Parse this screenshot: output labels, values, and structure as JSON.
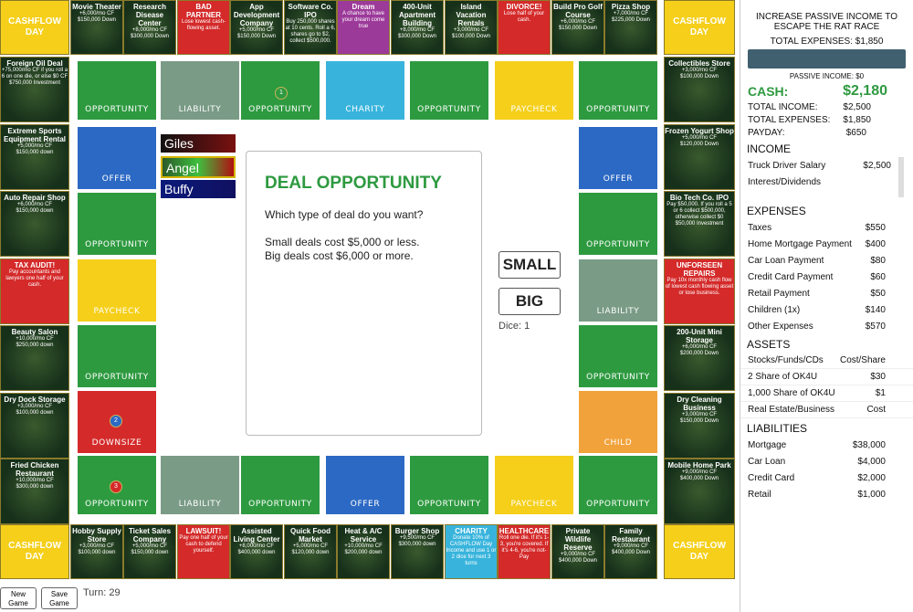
{
  "top_row": [
    {
      "title": "Movie Theater",
      "sub": "+6,000/mo CF\n$150,000 Down",
      "style": "deal"
    },
    {
      "title": "Research Disease Center",
      "sub": "+8,000/mo CF\n$300,000 Down",
      "style": "deal"
    },
    {
      "title": "BAD PARTNER",
      "sub": "Lose lowest cash-flowing asset.",
      "style": "red"
    },
    {
      "title": "App Development Company",
      "sub": "+5,000/mo CF\n$150,000 Down",
      "style": "deal"
    },
    {
      "title": "Software Co. IPO",
      "sub": "Buy 250,000 shares at 10 cents. Roll a 6, shares go to $2, collect $500,000.",
      "style": "deal"
    },
    {
      "title": "Dream",
      "sub": "A chance to have your dream come true",
      "style": "purple"
    },
    {
      "title": "400-Unit Apartment Building",
      "sub": "+8,000/mo CF\n$300,000 Down",
      "style": "deal"
    },
    {
      "title": "Island Vacation Rentals",
      "sub": "+3,000/mo CF\n$100,000 Down",
      "style": "deal"
    },
    {
      "title": "DIVORCE!",
      "sub": "Lose half of your cash.",
      "style": "red"
    },
    {
      "title": "Build Pro Golf Course",
      "sub": "+6,000/mo CF\n$150,000 Down",
      "style": "deal"
    },
    {
      "title": "Pizza Shop",
      "sub": "+7,000/mo CF\n$225,000 Down",
      "style": "deal"
    }
  ],
  "bottom_row": [
    {
      "title": "Hobby Supply Store",
      "sub": "+3,000/mo CF\n$100,000 down",
      "style": "deal"
    },
    {
      "title": "Ticket Sales Company",
      "sub": "+5,000/mo CF\n$150,000 down",
      "style": "deal"
    },
    {
      "title": "LAWSUIT!",
      "sub": "Pay one half of your cash to defend yourself.",
      "style": "red"
    },
    {
      "title": "Assisted Living Center",
      "sub": "+8,000/mo CF\n$400,000 down",
      "style": "deal"
    },
    {
      "title": "Quick Food Market",
      "sub": "+5,000/mo CF\n$120,000 down",
      "style": "deal"
    },
    {
      "title": "Heat & A/C Service",
      "sub": "+10,000/mo CF\n$200,000 down",
      "style": "deal"
    },
    {
      "title": "Burger Shop",
      "sub": "+9,500/mo CF\n$300,000 down",
      "style": "deal"
    },
    {
      "title": "CHARITY",
      "sub": "Donate 10% of CASHFLOW Day Income and use 1 or 2 dice for next 3 turns",
      "style": "cyan"
    },
    {
      "title": "HEALTHCARE",
      "sub": "Roll one die. If it's 1-3, you're covered. If it's 4-6, you're not- Pay",
      "style": "red"
    },
    {
      "title": "Private Wildlife Reserve",
      "sub": "+9,000/mo CF\n$400,000 Down",
      "style": "deal"
    },
    {
      "title": "Family Restaurant",
      "sub": "+9,000/mo CF\n$400,000 Down",
      "style": "deal"
    }
  ],
  "left_col": [
    {
      "title": "Foreign Oil Deal",
      "sub": "+75,000/mo CF if you roll a 6 on one die, or else $0 CF\n$750,000 Investment",
      "style": "deal"
    },
    {
      "title": "Extreme Sports Equipment Rental",
      "sub": "+5,000/mo CF\n$150,000 down",
      "style": "deal"
    },
    {
      "title": "Auto Repair Shop",
      "sub": "+6,000/mo CF\n$150,000 down",
      "style": "deal"
    },
    {
      "title": "TAX AUDIT!",
      "sub": "Pay accountants and lawyers one half of your cash.",
      "style": "red"
    },
    {
      "title": "Beauty Salon",
      "sub": "+10,000/mo CF\n$250,000 down",
      "style": "deal"
    },
    {
      "title": "Dry Dock Storage",
      "sub": "+3,000/mo CF\n$100,000 down",
      "style": "deal"
    },
    {
      "title": "Fried Chicken Restaurant",
      "sub": "+10,000/mo CF\n$300,000 down",
      "style": "deal"
    }
  ],
  "right_col": [
    {
      "title": "Collectibles Store",
      "sub": "+3,000/mo CF\n$100,000 Down",
      "style": "deal"
    },
    {
      "title": "Frozen Yogurt Shop",
      "sub": "+5,000/mo CF\n$120,000 Down",
      "style": "deal"
    },
    {
      "title": "Bio Tech Co. IPO",
      "sub": "Pay $50,000. If you roll a 5 or 6 collect $500,000, otherwise collect $0\n$50,000 Investment",
      "style": "deal"
    },
    {
      "title": "UNFORSEEN REPAIRS",
      "sub": "Pay 10x monthly cash flow of lowest cash flowing asset or lose business.",
      "style": "red"
    },
    {
      "title": "200-Unit Mini Storage",
      "sub": "+6,000/mo CF\n$200,000 Down",
      "style": "deal"
    },
    {
      "title": "Dry Cleaning Business",
      "sub": "+3,000/mo CF\n$150,000 Down",
      "style": "deal"
    },
    {
      "title": "Mobile Home Park",
      "sub": "+9,000/mo CF\n$400,000 Down",
      "style": "deal"
    }
  ],
  "corner_label": "CASHFLOW DAY",
  "inner_top": [
    "OPPORTUNITY",
    "LIABILITY",
    "OPPORTUNITY",
    "CHARITY",
    "OPPORTUNITY",
    "PAYCHECK",
    "OPPORTUNITY"
  ],
  "inner_bottom": [
    "OPPORTUNITY",
    "LIABILITY",
    "OPPORTUNITY",
    "OFFER",
    "OPPORTUNITY",
    "PAYCHECK",
    "OPPORTUNITY"
  ],
  "inner_left": [
    "OFFER",
    "OPPORTUNITY",
    "PAYCHECK",
    "OPPORTUNITY",
    "DOWNSIZE"
  ],
  "inner_right": [
    "OFFER",
    "OPPORTUNITY",
    "LIABILITY",
    "OPPORTUNITY",
    "CHILD"
  ],
  "tokens": {
    "t1": "1",
    "t2": "2",
    "t3": "3"
  },
  "players": [
    "Giles",
    "Angel",
    "Buffy"
  ],
  "card": {
    "title": "DEAL OPPORTUNITY",
    "question": "Which type of deal do you want?",
    "line1": "Small deals cost $5,000 or less.",
    "line2": "Big deals cost $6,000 or more."
  },
  "buttons": {
    "small": "SMALL",
    "big": "BIG",
    "new_game": "New Game",
    "save_game": "Save Game"
  },
  "dice": "Dice: 1",
  "turn": "Turn: 29",
  "panel": {
    "goal": "INCREASE PASSIVE INCOME TO ESCAPE THE RAT RACE",
    "total_expenses_top": "TOTAL EXPENSES: $1,850",
    "passive_income": "PASSIVE INCOME: $0",
    "progress_fraction": 0,
    "cash_label": "CASH:",
    "cash_value": "$2,180",
    "total_income_label": "TOTAL INCOME:",
    "total_income": "$2,500",
    "total_expenses_label": "TOTAL EXPENSES:",
    "total_expenses": "$1,850",
    "payday_label": "PAYDAY:",
    "payday": "$650",
    "income_header": "INCOME",
    "income": [
      {
        "label": "Truck Driver Salary",
        "value": "$2,500"
      },
      {
        "label": "Interest/Dividends",
        "value": ""
      }
    ],
    "expenses_header": "EXPENSES",
    "expenses": [
      {
        "label": "Taxes",
        "value": "$550"
      },
      {
        "label": "Home Mortgage Payment",
        "value": "$400"
      },
      {
        "label": "Car Loan Payment",
        "value": "$80"
      },
      {
        "label": "Credit Card Payment",
        "value": "$60"
      },
      {
        "label": "Retail Payment",
        "value": "$50"
      },
      {
        "label": "Children (1x)",
        "value": "$140"
      },
      {
        "label": "Other Expenses",
        "value": "$570"
      }
    ],
    "assets_header": "ASSETS",
    "assets": [
      {
        "label": "Stocks/Funds/CDs",
        "value": "Cost/Share"
      },
      {
        "label": "2 Share of OK4U",
        "value": "$30"
      },
      {
        "label": "1,000 Share of OK4U",
        "value": "$1"
      },
      {
        "label": "Real Estate/Business",
        "value": "Cost"
      }
    ],
    "liabilities_header": "LIABILITIES",
    "liabilities": [
      {
        "label": "Mortgage",
        "value": "$38,000"
      },
      {
        "label": "Car Loan",
        "value": "$4,000"
      },
      {
        "label": "Credit Card",
        "value": "$2,000"
      },
      {
        "label": "Retail",
        "value": "$1,000"
      }
    ]
  },
  "colors": {
    "green": "#2e9a40",
    "red": "#d42a2a",
    "yellow": "#f5cf1a",
    "blue": "#2c69c4",
    "cyan": "#38b4dc",
    "gray": "#7a9b86",
    "orange": "#f2a23a",
    "purple": "#9c3a9a"
  }
}
